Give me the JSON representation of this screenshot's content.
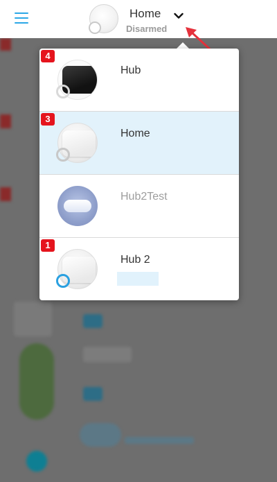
{
  "header": {
    "menu_icon": "hamburger-menu-icon",
    "active_hub": {
      "name": "Home",
      "status": "Disarmed"
    },
    "dropdown_icon": "chevron-down-icon"
  },
  "colors": {
    "accent": "#2ba7e6",
    "badge": "#e5141d",
    "selected_row": "#e2f2fb",
    "annotation_arrow": "#e5323c"
  },
  "hub_list": [
    {
      "name": "Hub",
      "badge": "4",
      "thumb": "black",
      "selected": false,
      "muted": false,
      "ring": "dark"
    },
    {
      "name": "Home",
      "badge": "3",
      "thumb": "white",
      "selected": true,
      "muted": false,
      "ring": "grey"
    },
    {
      "name": "Hub2Test",
      "badge": "",
      "thumb": "blue",
      "selected": false,
      "muted": true,
      "ring": ""
    },
    {
      "name": "Hub 2",
      "badge": "1",
      "thumb": "white",
      "selected": false,
      "muted": false,
      "ring": "blue"
    }
  ]
}
